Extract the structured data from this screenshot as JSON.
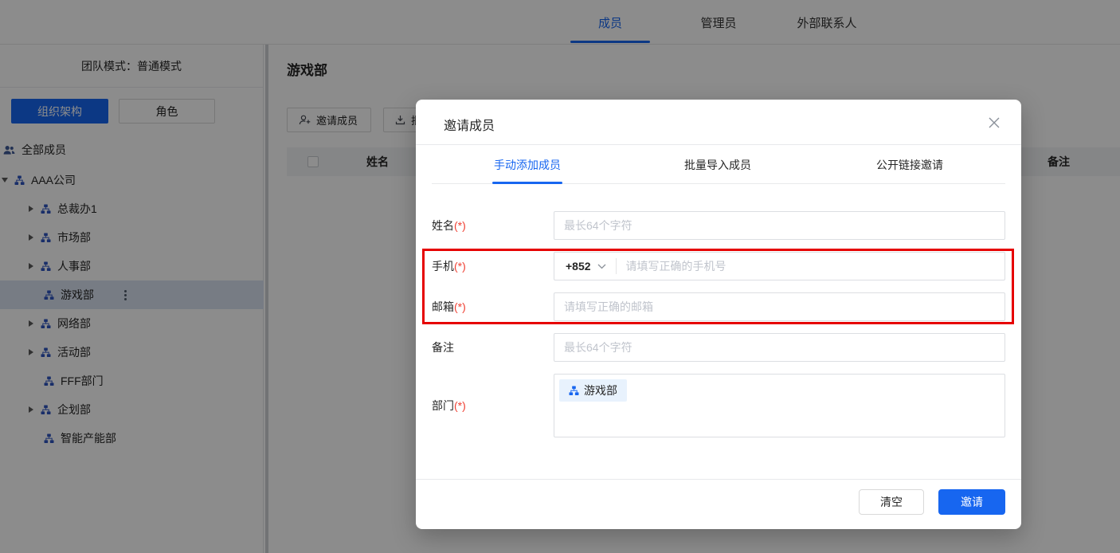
{
  "colors": {
    "primary": "#1766f0",
    "annotation_red": "#e60000",
    "required_red": "#f04134",
    "tag_bg": "#e8f2fd",
    "selected_row_bg": "#d9e2f1"
  },
  "top_nav": {
    "tabs": [
      {
        "label": "成员"
      },
      {
        "label": "管理员"
      },
      {
        "label": "外部联系人"
      }
    ]
  },
  "sidebar": {
    "team_mode": "团队模式：普通模式",
    "org_tab": "组织架构",
    "role_tab": "角色",
    "all_members": "全部成员",
    "company": "AAA公司",
    "departments": [
      {
        "label": "总裁办1"
      },
      {
        "label": "市场部"
      },
      {
        "label": "人事部"
      },
      {
        "label": "游戏部"
      },
      {
        "label": "网络部"
      },
      {
        "label": "活动部"
      },
      {
        "label": "FFF部门"
      },
      {
        "label": "企划部"
      },
      {
        "label": "智能产能部"
      }
    ]
  },
  "main": {
    "title": "游戏部",
    "invite_button": "邀请成员",
    "import_button_partial": "批",
    "table": {
      "name_header": "姓名",
      "remark_header": "备注"
    }
  },
  "modal": {
    "title": "邀请成员",
    "tabs": [
      {
        "label": "手动添加成员"
      },
      {
        "label": "批量导入成员"
      },
      {
        "label": "公开链接邀请"
      }
    ],
    "required_mark": "(*)",
    "fields": {
      "name": {
        "label": "姓名",
        "placeholder": "最长64个字符"
      },
      "phone": {
        "label": "手机",
        "country_code": "+852",
        "placeholder": "请填写正确的手机号"
      },
      "email": {
        "label": "邮箱",
        "placeholder": "请填写正确的邮箱"
      },
      "remark": {
        "label": "备注",
        "placeholder": "最长64个字符"
      },
      "department": {
        "label": "部门",
        "tag": "游戏部"
      }
    },
    "footer": {
      "clear": "清空",
      "invite": "邀请"
    }
  }
}
